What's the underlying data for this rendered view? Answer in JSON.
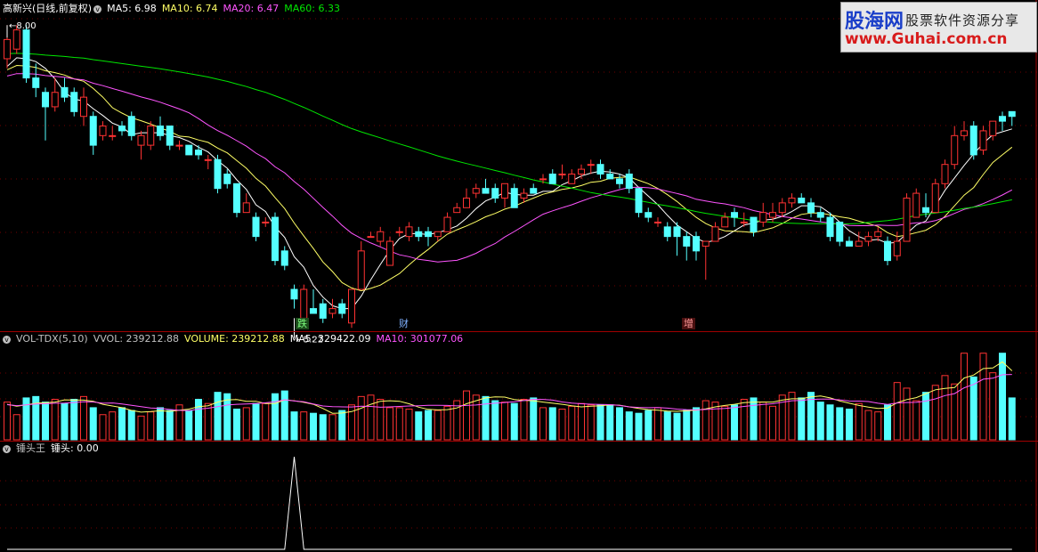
{
  "main_panel": {
    "stock_name": "高新兴(日线,前复权)",
    "ma5": "MA5: 6.98",
    "ma10": "MA10: 6.74",
    "ma20": "MA20: 6.47",
    "ma60": "MA60: 6.33",
    "high_label": "8.00",
    "low_label": "5.22",
    "markers": [
      "跌",
      "财",
      "增"
    ]
  },
  "volume_panel": {
    "indicator": "VOL-TDX(5,10)",
    "vvol": "VVOL: 239212.88",
    "volume": "VOLUME: 239212.88",
    "ma5": "MA5: 329422.09",
    "ma10": "MA10: 301077.06"
  },
  "hammer_panel": {
    "indicator": "锤头王",
    "value": "锤头: 0.00"
  },
  "watermark": {
    "brand": "股海网",
    "slogan": "股票软件资源分享",
    "url": "www.Guhai.com.cn"
  },
  "colors": {
    "up": "#ff3232",
    "down": "#54ffff",
    "ma5": "#ffffff",
    "ma10": "#ffff66",
    "ma20": "#ff55ff",
    "ma60": "#00e600",
    "divider": "#a00000",
    "grid": "#700000"
  },
  "chart_data": {
    "type": "candlestick",
    "price_range": [
      5.0,
      8.15
    ],
    "candles": [
      [
        7.65,
        7.85,
        7.55,
        8.0
      ],
      [
        7.75,
        7.95,
        7.7,
        8.0
      ],
      [
        7.95,
        7.45,
        7.4,
        8.0
      ],
      [
        7.45,
        7.35,
        7.25,
        7.6
      ],
      [
        7.3,
        7.15,
        6.8,
        7.35
      ],
      [
        7.15,
        7.3,
        7.1,
        7.45
      ],
      [
        7.35,
        7.25,
        7.2,
        7.45
      ],
      [
        7.3,
        7.1,
        7.05,
        7.35
      ],
      [
        7.05,
        7.25,
        6.95,
        7.35
      ],
      [
        7.05,
        6.75,
        6.65,
        7.1
      ],
      [
        6.85,
        6.95,
        6.8,
        7.0
      ],
      [
        6.85,
        6.85,
        6.8,
        6.95
      ],
      [
        6.95,
        6.9,
        6.85,
        7.0
      ],
      [
        7.05,
        6.85,
        6.8,
        7.1
      ],
      [
        6.75,
        6.85,
        6.6,
        6.9
      ],
      [
        6.75,
        6.95,
        6.7,
        7.0
      ],
      [
        6.95,
        6.85,
        6.8,
        7.05
      ],
      [
        6.95,
        6.75,
        6.7,
        6.95
      ],
      [
        6.75,
        6.75,
        6.7,
        6.8
      ],
      [
        6.75,
        6.65,
        6.65,
        6.75
      ],
      [
        6.7,
        6.65,
        6.6,
        6.75
      ],
      [
        6.6,
        6.6,
        6.5,
        6.65
      ],
      [
        6.6,
        6.3,
        6.25,
        6.65
      ],
      [
        6.45,
        6.35,
        6.3,
        6.5
      ],
      [
        6.35,
        6.05,
        6.0,
        6.35
      ],
      [
        6.05,
        6.15,
        6.05,
        6.25
      ],
      [
        6.0,
        5.8,
        5.75,
        6.05
      ],
      [
        5.95,
        5.95,
        5.9,
        6.0
      ],
      [
        6.0,
        5.55,
        5.5,
        6.05
      ],
      [
        5.65,
        5.5,
        5.45,
        5.7
      ],
      [
        5.25,
        5.15,
        5.05,
        5.3
      ],
      [
        4.95,
        5.25,
        4.95,
        5.3
      ],
      [
        5.05,
        5.0,
        5.0,
        5.25
      ],
      [
        5.1,
        4.95,
        4.9,
        5.15
      ],
      [
        5.0,
        5.05,
        4.95,
        5.15
      ],
      [
        5.1,
        5.0,
        4.95,
        5.15
      ],
      [
        4.9,
        5.25,
        4.85,
        5.25
      ],
      [
        5.25,
        5.65,
        5.25,
        5.75
      ],
      [
        5.8,
        5.8,
        5.8,
        5.85
      ],
      [
        5.75,
        5.85,
        5.7,
        5.9
      ],
      [
        5.5,
        5.75,
        5.5,
        5.8
      ],
      [
        5.85,
        5.85,
        5.8,
        5.9
      ],
      [
        5.8,
        5.9,
        5.75,
        5.95
      ],
      [
        5.85,
        5.8,
        5.75,
        5.9
      ],
      [
        5.85,
        5.8,
        5.7,
        5.9
      ],
      [
        5.8,
        5.85,
        5.75,
        5.85
      ],
      [
        5.85,
        6.0,
        5.85,
        6.05
      ],
      [
        6.05,
        6.1,
        6.05,
        6.15
      ],
      [
        6.1,
        6.2,
        6.1,
        6.3
      ],
      [
        6.25,
        6.3,
        6.2,
        6.35
      ],
      [
        6.3,
        6.25,
        6.25,
        6.4
      ],
      [
        6.3,
        6.2,
        6.15,
        6.35
      ],
      [
        6.2,
        6.35,
        6.1,
        6.35
      ],
      [
        6.3,
        6.1,
        6.1,
        6.35
      ],
      [
        6.2,
        6.25,
        6.15,
        6.3
      ],
      [
        6.3,
        6.25,
        6.25,
        6.35
      ],
      [
        6.4,
        6.4,
        6.35,
        6.45
      ],
      [
        6.45,
        6.35,
        6.35,
        6.5
      ],
      [
        6.45,
        6.45,
        6.4,
        6.55
      ],
      [
        6.35,
        6.45,
        6.35,
        6.5
      ],
      [
        6.45,
        6.5,
        6.4,
        6.55
      ],
      [
        6.55,
        6.55,
        6.45,
        6.6
      ],
      [
        6.55,
        6.45,
        6.4,
        6.6
      ],
      [
        6.45,
        6.4,
        6.4,
        6.5
      ],
      [
        6.4,
        6.35,
        6.3,
        6.45
      ],
      [
        6.45,
        6.3,
        6.25,
        6.5
      ],
      [
        6.3,
        6.05,
        6.0,
        6.3
      ],
      [
        6.05,
        6.0,
        5.95,
        6.1
      ],
      [
        5.95,
        5.95,
        5.9,
        6.0
      ],
      [
        5.9,
        5.8,
        5.75,
        5.95
      ],
      [
        5.9,
        5.8,
        5.6,
        5.95
      ],
      [
        5.8,
        5.7,
        5.55,
        5.85
      ],
      [
        5.8,
        5.65,
        5.55,
        5.85
      ],
      [
        5.7,
        5.75,
        5.35,
        5.75
      ],
      [
        5.75,
        5.9,
        5.75,
        5.95
      ],
      [
        5.9,
        6.0,
        5.9,
        6.05
      ],
      [
        6.05,
        6.0,
        5.9,
        6.1
      ],
      [
        5.95,
        5.95,
        5.9,
        6.05
      ],
      [
        6.0,
        5.85,
        5.8,
        6.0
      ],
      [
        5.95,
        6.05,
        5.9,
        6.15
      ],
      [
        6.0,
        6.05,
        5.95,
        6.15
      ],
      [
        6.05,
        6.15,
        6.0,
        6.2
      ],
      [
        6.15,
        6.2,
        6.1,
        6.25
      ],
      [
        6.2,
        6.15,
        6.15,
        6.25
      ],
      [
        6.15,
        6.05,
        6.0,
        6.2
      ],
      [
        6.05,
        6.0,
        5.95,
        6.1
      ],
      [
        6.0,
        5.8,
        5.75,
        6.05
      ],
      [
        5.95,
        5.75,
        5.7,
        5.95
      ],
      [
        5.75,
        5.7,
        5.7,
        5.8
      ],
      [
        5.7,
        5.75,
        5.7,
        5.85
      ],
      [
        5.75,
        5.8,
        5.7,
        5.85
      ],
      [
        5.8,
        5.85,
        5.75,
        5.9
      ],
      [
        5.75,
        5.55,
        5.5,
        5.8
      ],
      [
        5.6,
        5.75,
        5.55,
        5.85
      ],
      [
        5.75,
        6.2,
        5.75,
        6.25
      ],
      [
        6.0,
        6.25,
        6.0,
        6.3
      ],
      [
        6.1,
        6.05,
        6.0,
        6.25
      ],
      [
        6.05,
        6.35,
        6.05,
        6.4
      ],
      [
        6.35,
        6.55,
        6.3,
        6.6
      ],
      [
        6.55,
        6.85,
        6.5,
        6.95
      ],
      [
        6.85,
        6.9,
        6.8,
        7.0
      ],
      [
        6.95,
        6.65,
        6.6,
        7.0
      ],
      [
        6.7,
        6.9,
        6.65,
        6.95
      ],
      [
        6.85,
        7.0,
        6.8,
        7.0
      ],
      [
        7.05,
        7.0,
        6.9,
        7.1
      ],
      [
        7.1,
        7.05,
        6.95,
        7.1
      ]
    ],
    "volume_range": [
      0,
      650000
    ],
    "volumes": [
      270000,
      180000,
      300000,
      310000,
      270000,
      290000,
      260000,
      290000,
      310000,
      230000,
      180000,
      200000,
      230000,
      210000,
      170000,
      200000,
      230000,
      210000,
      250000,
      210000,
      290000,
      260000,
      340000,
      330000,
      220000,
      230000,
      260000,
      260000,
      330000,
      350000,
      200000,
      200000,
      190000,
      180000,
      180000,
      210000,
      250000,
      310000,
      320000,
      290000,
      230000,
      230000,
      220000,
      200000,
      210000,
      210000,
      240000,
      280000,
      350000,
      320000,
      310000,
      280000,
      270000,
      260000,
      290000,
      300000,
      230000,
      230000,
      220000,
      240000,
      260000,
      250000,
      250000,
      250000,
      230000,
      200000,
      190000,
      210000,
      230000,
      200000,
      190000,
      210000,
      230000,
      280000,
      270000,
      240000,
      250000,
      290000,
      300000,
      270000,
      240000,
      320000,
      340000,
      300000,
      340000,
      270000,
      250000,
      230000,
      220000,
      260000,
      210000,
      200000,
      250000,
      410000,
      370000,
      280000,
      340000,
      390000,
      460000,
      400000,
      620000,
      450000,
      620000,
      480000,
      620000,
      300000
    ],
    "hammer_signal_index": 30,
    "signal_range": [
      0,
      1
    ]
  }
}
